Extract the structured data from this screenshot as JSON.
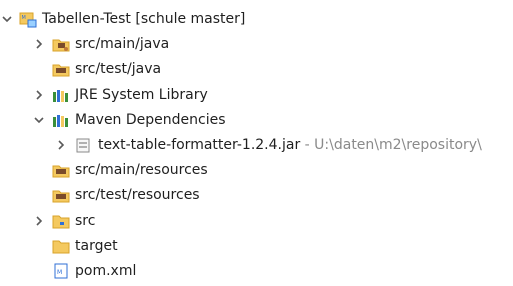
{
  "tree": {
    "project": {
      "label": "Tabellen-Test [schule master]",
      "icon": "maven-project-icon",
      "expanded": true
    },
    "items": [
      {
        "label": "src/main/java",
        "icon": "source-folder-icon",
        "expandable": true,
        "expanded": false
      },
      {
        "label": "src/test/java",
        "icon": "source-folder-icon",
        "expandable": false
      },
      {
        "label": "JRE System Library",
        "icon": "library-icon",
        "expandable": true,
        "expanded": false
      },
      {
        "label": "Maven Dependencies",
        "icon": "library-icon",
        "expandable": true,
        "expanded": true
      },
      {
        "label": "text-table-formatter-1.2.4.jar",
        "decoration": " - U:\\daten\\m2\\repository\\",
        "icon": "jar-icon",
        "expandable": true,
        "expanded": false
      },
      {
        "label": "src/main/resources",
        "icon": "source-folder-icon",
        "expandable": false
      },
      {
        "label": "src/test/resources",
        "icon": "source-folder-icon",
        "expandable": false
      },
      {
        "label": "src",
        "icon": "folder-icon",
        "expandable": true,
        "expanded": false
      },
      {
        "label": "target",
        "icon": "folder-icon",
        "expandable": false
      },
      {
        "label": "pom.xml",
        "icon": "pom-file-icon",
        "expandable": false
      }
    ]
  },
  "colors": {
    "toggle": "#5a5a5a",
    "folder": "#f4c960",
    "folder_dark": "#d8a32a",
    "package": "#7a4b2a",
    "source_dot": "#c07a3a",
    "library_green": "#3a8f3a",
    "library_blue": "#2f6fd6",
    "decoration_text": "#8a8a8a"
  }
}
